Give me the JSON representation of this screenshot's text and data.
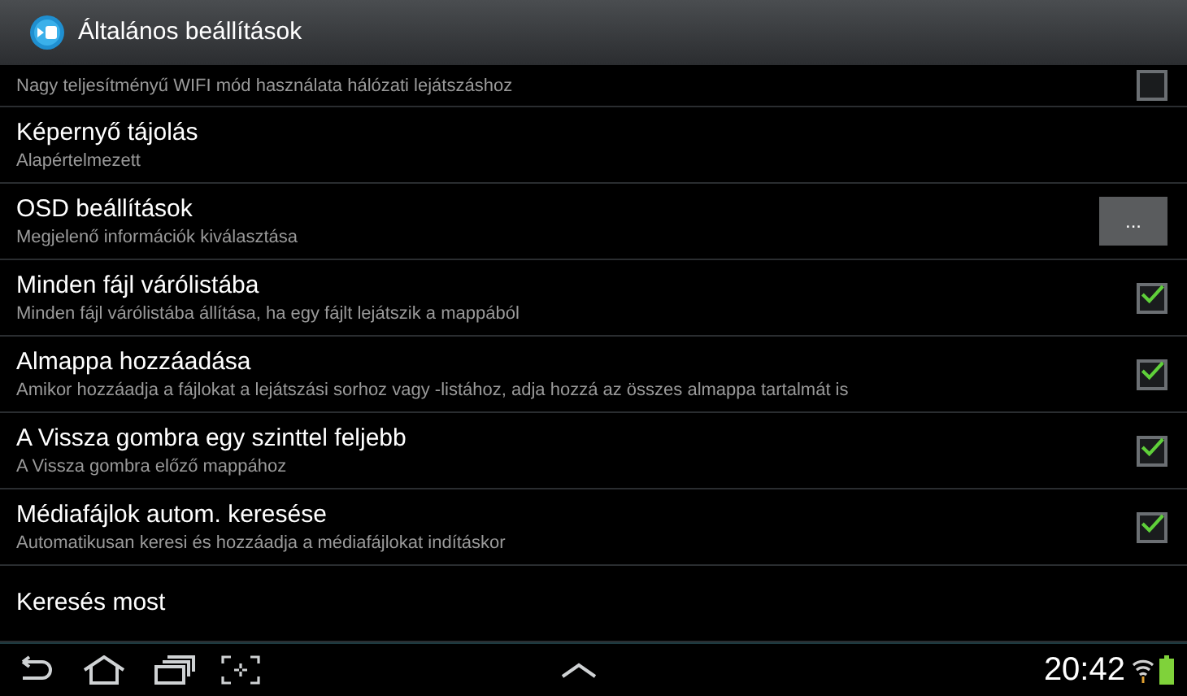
{
  "window": {
    "title": "Általános beállítások"
  },
  "settings": [
    {
      "kind": "checkbox",
      "summary": "Nagy teljesítményű WIFI mód használata hálózati lejátszáshoz",
      "checked": false
    },
    {
      "kind": "plain",
      "title": "Képernyő tájolás",
      "summary": "Alapértelmezett"
    },
    {
      "kind": "button",
      "title": "OSD beállítások",
      "summary": "Megjelenő információk kiválasztása",
      "button": "..."
    },
    {
      "kind": "checkbox",
      "title": "Minden fájl várólistába",
      "summary": "Minden fájl várólistába állítása, ha egy fájlt lejátszik a mappából",
      "checked": true
    },
    {
      "kind": "checkbox",
      "title": "Almappa hozzáadása",
      "summary": "Amikor hozzáadja a fájlokat a lejátszási sorhoz vagy -listához, adja hozzá az összes almappa tartalmát is",
      "checked": true
    },
    {
      "kind": "checkbox",
      "title": "A Vissza gombra egy szinttel feljebb",
      "summary": "A Vissza gombra előző mappához",
      "checked": true
    },
    {
      "kind": "checkbox",
      "title": "Médiafájlok autom. keresése",
      "summary": "Automatikusan keresi és hozzáadja a médiafájlokat indításkor",
      "checked": true
    },
    {
      "kind": "plain",
      "title": "Keresés most"
    }
  ],
  "status_bar": {
    "time": "20:42"
  }
}
